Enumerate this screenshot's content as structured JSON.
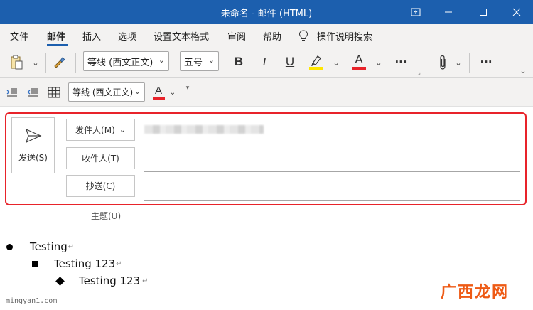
{
  "window": {
    "title": "未命名 - 邮件 (HTML)"
  },
  "menu": {
    "items": [
      "文件",
      "邮件",
      "插入",
      "选项",
      "设置文本格式",
      "审阅",
      "帮助"
    ],
    "active": "邮件",
    "tell_me": "操作说明搜索"
  },
  "ribbon": {
    "font_name": "等线 (西文正文)",
    "font_size": "五号",
    "bold": "B",
    "italic": "I",
    "underline": "U",
    "font_color": "A",
    "more": "···",
    "highlight_color": "#ffe600",
    "font_color_value": "#e8232a"
  },
  "ribbon2": {
    "font_name": "等线 (西文正文)",
    "font_color": "A"
  },
  "compose": {
    "send_label": "发送(S)",
    "from_label": "发件人(M)",
    "to_label": "收件人(T)",
    "cc_label": "抄送(C)",
    "subject_label": "主题(U)"
  },
  "body": {
    "lines": [
      "Testing",
      "Testing 123",
      "Testing 123"
    ]
  },
  "watermark": {
    "left": "mingyan1.com",
    "right": "广西龙网"
  }
}
